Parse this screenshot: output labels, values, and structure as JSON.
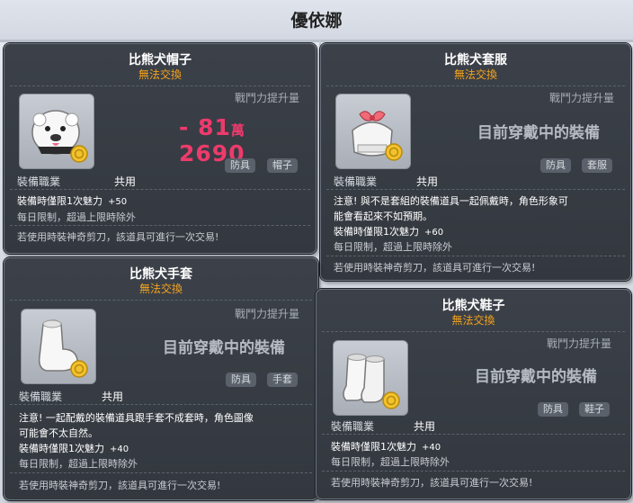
{
  "header": {
    "title": "優依娜"
  },
  "labels": {
    "trade": "無法交換",
    "power": "戰鬥力提升量",
    "equipped": "目前穿戴中的裝備",
    "job": "裝備職業",
    "job_value": "共用",
    "daily": "每日限制，超過上限時除外",
    "scissors": "若使用時裝神奇剪刀，該道具可進行一次交易!",
    "charm": "裝備時僅限1次魅力"
  },
  "items": {
    "hat": {
      "name": "比熊犬帽子",
      "power_main": "- 81",
      "power_unit": "萬",
      "power_tail": " 2690",
      "tags": [
        "防具",
        "帽子"
      ],
      "charm_bonus": "+50"
    },
    "suit": {
      "name": "比熊犬套服",
      "tags": [
        "防具",
        "套服"
      ],
      "warning_1": "注意! 與不是套組的裝備道具一起佩戴時，角色形象可",
      "warning_2": "能會看起來不如預期。",
      "charm_bonus": "+60"
    },
    "glove": {
      "name": "比熊犬手套",
      "tags": [
        "防具",
        "手套"
      ],
      "warning_1": "注意! 一起配戴的裝備道具跟手套不成套時，角色圖像",
      "warning_2": "可能會不太自然。",
      "charm_bonus": "+40"
    },
    "shoes": {
      "name": "比熊犬鞋子",
      "tags": [
        "防具",
        "鞋子"
      ],
      "charm_bonus": "+40"
    }
  },
  "colors": {
    "panel_bg": "#363b42",
    "trade_orange": "#f4a21c",
    "power_red": "#ee3a6c",
    "tag_bg": "#5b616b"
  }
}
